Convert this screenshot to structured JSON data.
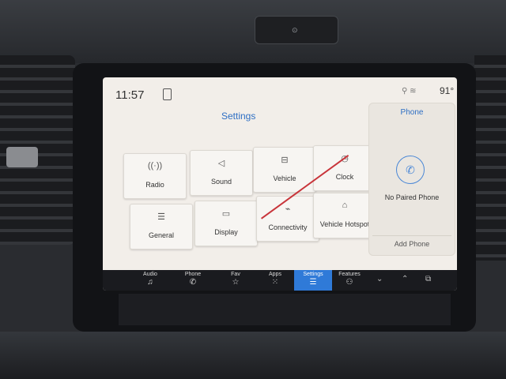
{
  "status": {
    "time": "11:57",
    "temperature": "91°"
  },
  "settings": {
    "title": "Settings",
    "tiles": [
      {
        "label": "Radio",
        "icon": "radio-antenna-icon"
      },
      {
        "label": "Sound",
        "icon": "speaker-icon"
      },
      {
        "label": "Vehicle",
        "icon": "vehicle-settings-icon"
      },
      {
        "label": "Clock",
        "icon": "clock-icon"
      },
      {
        "label": "General",
        "icon": "sliders-icon"
      },
      {
        "label": "Display",
        "icon": "display-icon"
      },
      {
        "label": "Connectivity",
        "icon": "connectivity-icon"
      },
      {
        "label": "Vehicle Hotspot",
        "icon": "hotspot-icon"
      }
    ]
  },
  "phone_panel": {
    "title": "Phone",
    "status": "No Paired Phone",
    "add_button": "Add Phone"
  },
  "navbar": {
    "items": [
      {
        "label": "Audio",
        "icon": "music-note-icon"
      },
      {
        "label": "Phone",
        "icon": "phone-icon"
      },
      {
        "label": "Fav",
        "icon": "star-icon"
      },
      {
        "label": "Apps",
        "icon": "apps-grid-icon"
      },
      {
        "label": "Settings",
        "icon": "settings-sliders-icon"
      },
      {
        "label": "Features",
        "icon": "car-features-icon"
      }
    ],
    "active": "Settings"
  },
  "colors": {
    "accent": "#2e6fc4",
    "nav_active": "#2f7ad8",
    "screen_bg": "#f2eee9"
  }
}
